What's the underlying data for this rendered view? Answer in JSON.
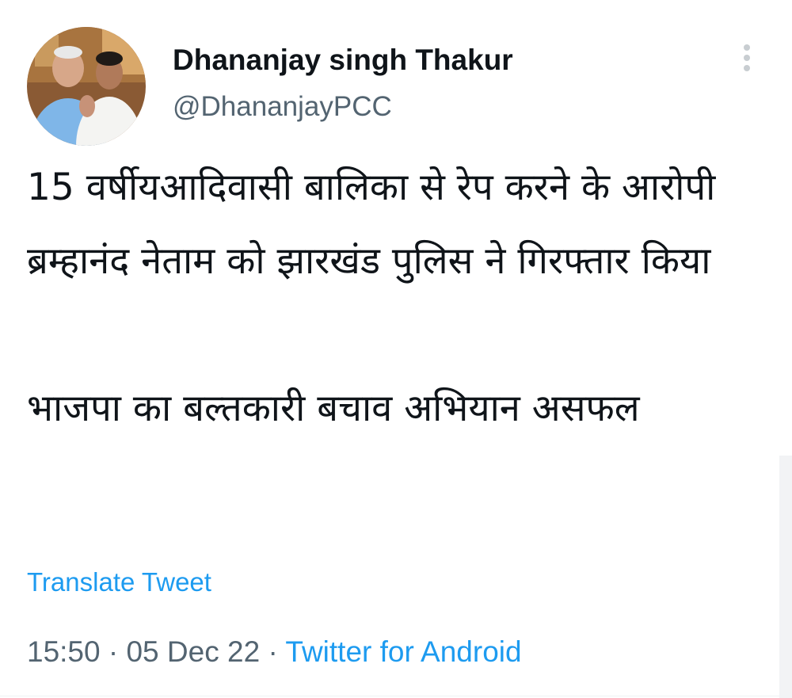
{
  "author": {
    "display_name": "Dhananjay singh Thakur",
    "handle": "@DhananjayPCC",
    "avatar_icon": "profile-photo"
  },
  "more_icon": "vertical-ellipsis-icon",
  "tweet": {
    "text": "15 वर्षीयआदिवासी बालिका से रेप करने के आरोपी ब्रम्हानंद नेताम को झारखंड पुलिस ने गिरफ्तार किया\n\nभाजपा का बल्तकारी बचाव अभियान असफल",
    "translate_label": "Translate Tweet",
    "time": "15:50",
    "date": "05 Dec 22",
    "separator": "·",
    "source": "Twitter for Android"
  },
  "colors": {
    "link": "#1d9bf0",
    "secondary_text": "#536471",
    "primary_text": "#0f1419"
  }
}
